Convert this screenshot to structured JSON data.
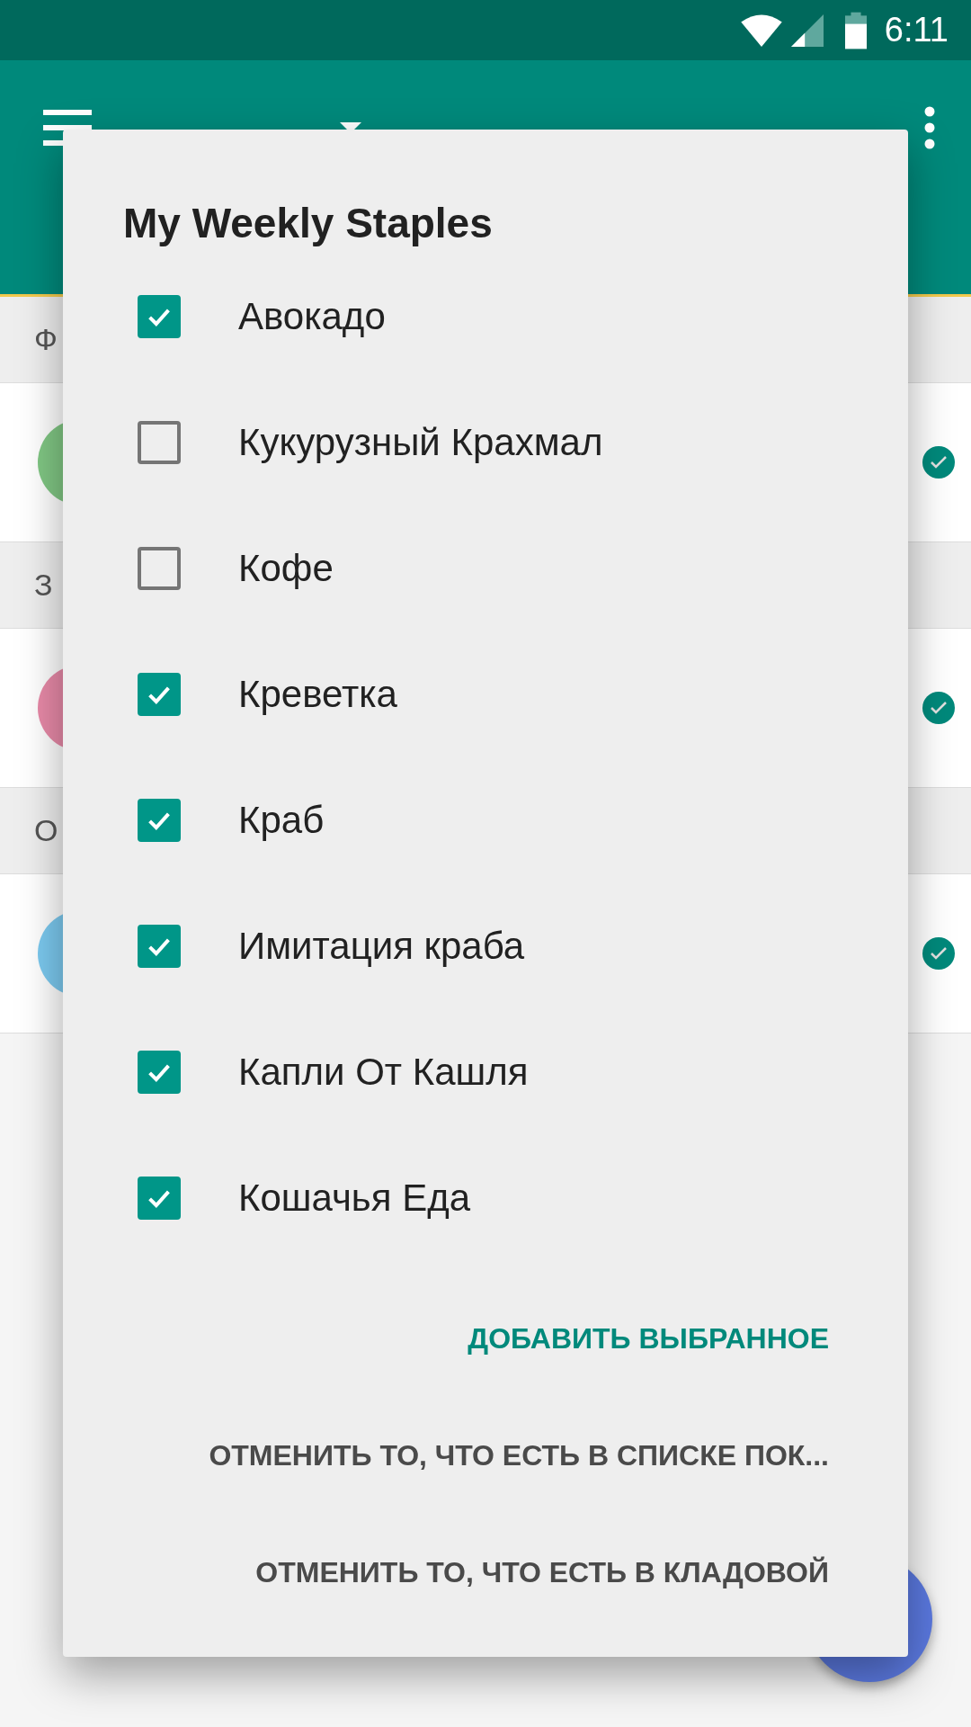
{
  "status_bar": {
    "time": "6:11"
  },
  "sections": [
    {
      "header": "Ф",
      "item": {
        "color": "#81c784",
        "checked": true
      }
    },
    {
      "header": "З",
      "item": {
        "color": "#e88aa8",
        "checked": true
      }
    },
    {
      "header": "О",
      "item": {
        "color": "#7ccaf0",
        "checked": true
      }
    }
  ],
  "dialog": {
    "title": "My Weekly Staples",
    "items": [
      {
        "label": "Авокадо",
        "checked": true
      },
      {
        "label": "Кукурузный Крахмал",
        "checked": false
      },
      {
        "label": "Кофе",
        "checked": false
      },
      {
        "label": "Креветка",
        "checked": true
      },
      {
        "label": "Краб",
        "checked": true
      },
      {
        "label": "Имитация краба",
        "checked": true
      },
      {
        "label": "Капли От Кашля",
        "checked": true
      },
      {
        "label": "Кошачья Еда",
        "checked": true
      }
    ],
    "buttons": [
      {
        "label": "ДОБАВИТЬ ВЫБРАННОЕ",
        "kind": "primary"
      },
      {
        "label": "ОТМЕНИТЬ ТО, ЧТО ЕСТЬ В СПИСКЕ ПОК...",
        "kind": "secondary"
      },
      {
        "label": "ОТМЕНИТЬ ТО, ЧТО ЕСТЬ В КЛАДОВОЙ",
        "kind": "secondary"
      }
    ]
  }
}
